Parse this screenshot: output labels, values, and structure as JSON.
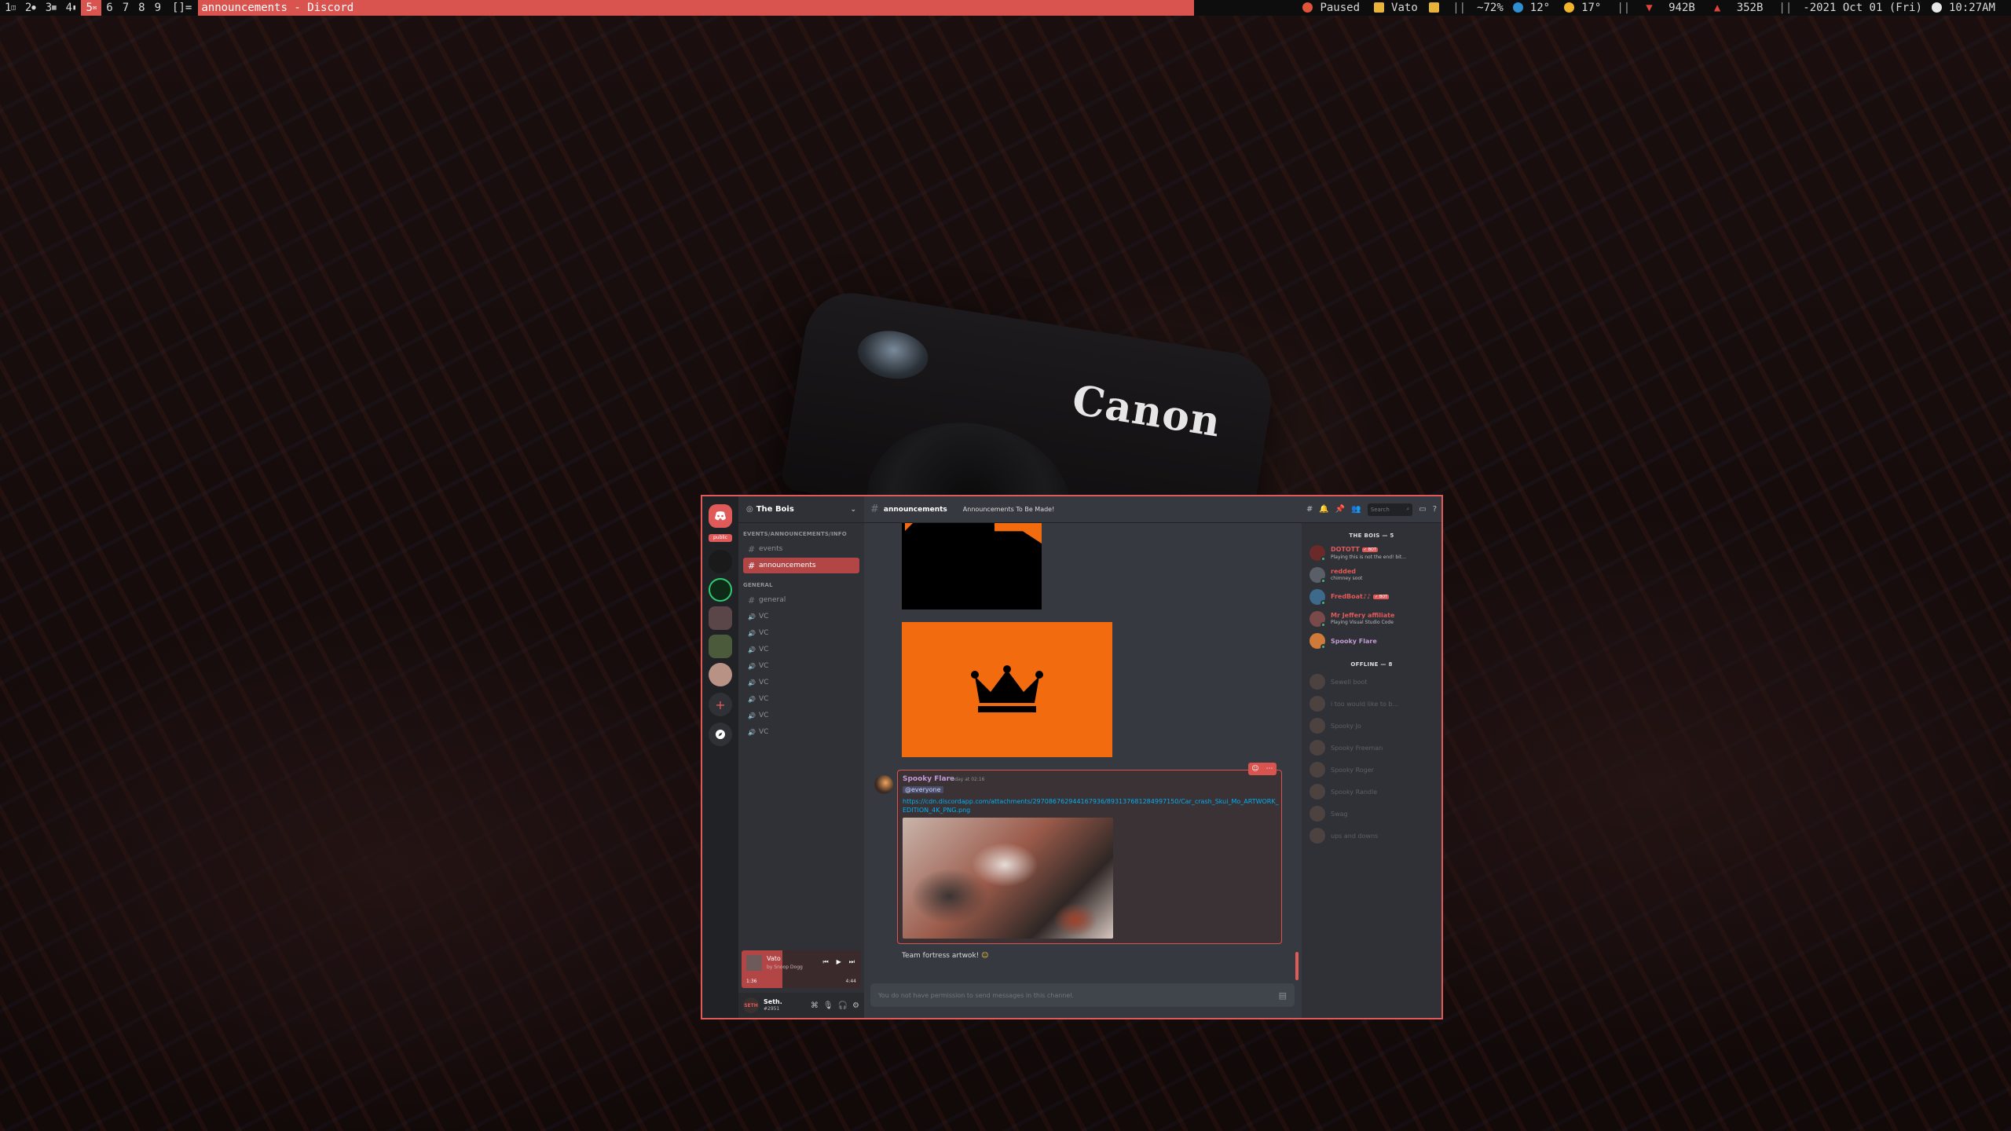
{
  "topbar": {
    "workspaces": [
      {
        "label": "1",
        "badge": "◫",
        "active": false
      },
      {
        "label": "2",
        "badge": "●",
        "active": false
      },
      {
        "label": "3",
        "badge": "▦",
        "active": false
      },
      {
        "label": "4",
        "badge": "▮",
        "active": false
      },
      {
        "label": "5",
        "badge": "✉",
        "active": true
      },
      {
        "label": "6",
        "badge": "",
        "active": false
      },
      {
        "label": "7",
        "badge": "",
        "active": false
      },
      {
        "label": "8",
        "badge": "",
        "active": false
      },
      {
        "label": "9",
        "badge": "",
        "active": false
      }
    ],
    "layout": "[]=",
    "window_title": "announcements - Discord",
    "music_state": "Paused",
    "music_artist": "Vato",
    "battery": "~72%",
    "weather_1": "12°",
    "weather_2": "17°",
    "net_down": "942B",
    "net_up": "352B",
    "date": "-2021 Oct 01 (Fri)",
    "time": "10:27AM",
    "separator": "||",
    "accent_color": "#d9534f"
  },
  "discord": {
    "server": {
      "name": "The Bois",
      "chevron": "⌄"
    },
    "guild_badge": "public",
    "categories": [
      {
        "label": "EVENTS/ANNOUNCEMENTS/INFO",
        "channels": [
          {
            "type": "text",
            "name": "events",
            "selected": false
          },
          {
            "type": "text",
            "name": "announcements",
            "selected": true
          }
        ]
      },
      {
        "label": "GENERAL",
        "channels": [
          {
            "type": "text",
            "name": "general",
            "selected": false
          },
          {
            "type": "voice",
            "name": "VC",
            "selected": false
          },
          {
            "type": "voice",
            "name": "VC",
            "selected": false
          },
          {
            "type": "voice",
            "name": "VC",
            "selected": false
          },
          {
            "type": "voice",
            "name": "VC",
            "selected": false
          },
          {
            "type": "voice",
            "name": "VC",
            "selected": false
          },
          {
            "type": "voice",
            "name": "VC",
            "selected": false
          },
          {
            "type": "voice",
            "name": "VC",
            "selected": false
          },
          {
            "type": "voice",
            "name": "VC",
            "selected": false
          }
        ]
      }
    ],
    "now_playing": {
      "title": "Vato",
      "artist": "by Snoop Dogg",
      "elapsed": "1:36",
      "duration": "4:44",
      "progress": 0.34
    },
    "user": {
      "name": "Seth.",
      "tag": "#2951",
      "avatar_text": "SETH"
    },
    "header": {
      "channel": "announcements",
      "topic": "Announcements To Be Made!",
      "search_placeholder": "Search"
    },
    "message": {
      "author": "Spooky Flare",
      "timestamp": "Today at 02:16",
      "mention": "@everyone",
      "link": "https://cdn.discordapp.com/attachments/297086762944167936/893137681284997150/Car_crash_Skui_Mo_ARTWORK_EDITION_4K_PNG.png"
    },
    "followup_text": "Team fortress artwok!",
    "composer_placeholder": "You do not have permission to send messages in this channel.",
    "members": {
      "online_header": "THE BOIS — 5",
      "offline_header": "OFFLINE — 8",
      "online": [
        {
          "name": "DOTOTT",
          "tag": "✓ BOT",
          "sub": "Playing this is not the end! bit..."
        },
        {
          "name": "redded",
          "tag": "",
          "sub": "chimney soot"
        },
        {
          "name": "FredBoat♪♪",
          "tag": "✓ BOT",
          "sub": ""
        },
        {
          "name": "Mr Jeffery affiliate",
          "tag": "",
          "sub": "Playing Visual Studio Code"
        },
        {
          "name": "Spooky Flare",
          "tag": "",
          "sub": ""
        }
      ],
      "offline": [
        {
          "name": "Sewell boot"
        },
        {
          "name": "i too would like to b..."
        },
        {
          "name": "Spooky Jo"
        },
        {
          "name": "Spooky Freeman"
        },
        {
          "name": "Spooky Roger"
        },
        {
          "name": "Spooky Randle"
        },
        {
          "name": "Swag"
        },
        {
          "name": "ups and downs"
        }
      ]
    }
  }
}
